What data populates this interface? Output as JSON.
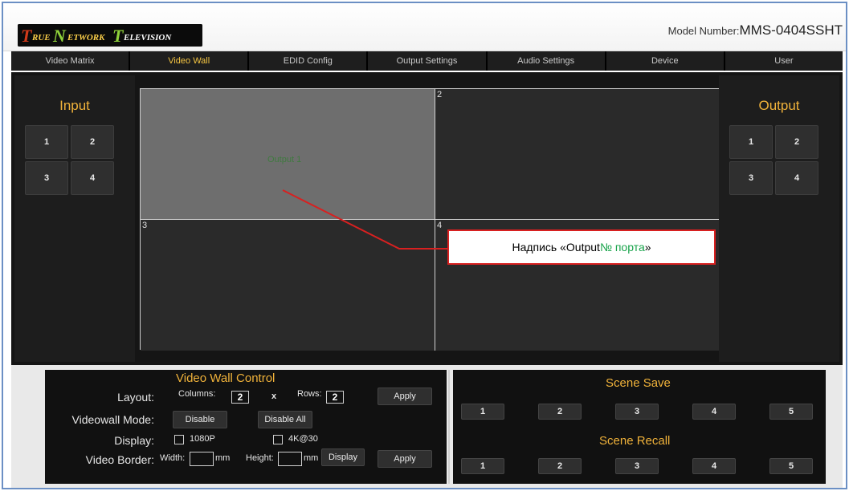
{
  "header": {
    "logo_text": "True Network Television",
    "model_label": "Model Number:",
    "model_value": "MMS-0404SSHT"
  },
  "nav": {
    "tabs": [
      {
        "label": "Video Matrix",
        "active": false
      },
      {
        "label": "Video Wall",
        "active": true
      },
      {
        "label": "EDID Config",
        "active": false
      },
      {
        "label": "Output Settings",
        "active": false
      },
      {
        "label": "Audio Settings",
        "active": false
      },
      {
        "label": "Device",
        "active": false
      },
      {
        "label": "User",
        "active": false
      }
    ]
  },
  "input_panel": {
    "title": "Input",
    "ports": [
      "1",
      "2",
      "3",
      "4"
    ]
  },
  "output_panel": {
    "title": "Output",
    "ports": [
      "1",
      "2",
      "3",
      "4"
    ]
  },
  "wall": {
    "cells": [
      "",
      "2",
      "3",
      "4"
    ],
    "output_label": "Output 1"
  },
  "annotation": {
    "prefix": "Надпись «Output ",
    "highlight": "№ порта",
    "suffix": "»"
  },
  "control": {
    "title": "Video Wall Control",
    "layout_label": "Layout:",
    "columns_label": "Columns:",
    "columns_value": "2",
    "x_label": "x",
    "rows_label": "Rows:",
    "rows_value": "2",
    "apply_label": "Apply",
    "mode_label": "Videowall Mode:",
    "disable_label": "Disable",
    "disable_all_label": "Disable All",
    "display_label": "Display:",
    "opt_1080p": "1080P",
    "opt_4k30": "4K@30",
    "border_label": "Video Border:",
    "width_label": "Width:",
    "mm1": "mm",
    "height_label": "Height:",
    "mm2": "mm",
    "display_btn": "Display",
    "apply2_label": "Apply"
  },
  "scenes": {
    "save_title": "Scene Save",
    "recall_title": "Scene Recall",
    "save_buttons": [
      "1",
      "2",
      "3",
      "4",
      "5"
    ],
    "recall_buttons": [
      "1",
      "2",
      "3",
      "4",
      "5"
    ]
  },
  "colors": {
    "accent": "#f0b23a",
    "callout_border": "#d82020",
    "highlight_green": "#17a34a"
  }
}
